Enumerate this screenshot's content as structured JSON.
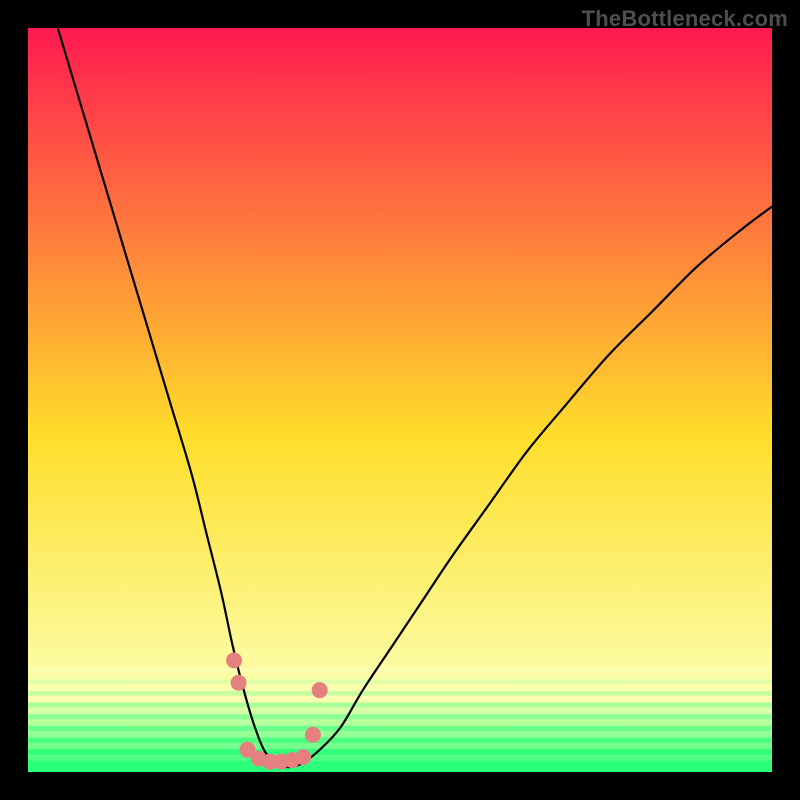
{
  "watermark": "TheBottleneck.com",
  "chart_data": {
    "type": "line",
    "title": "",
    "xlabel": "",
    "ylabel": "",
    "xlim": [
      0,
      100
    ],
    "ylim": [
      0,
      100
    ],
    "grid": false,
    "background_gradient": {
      "top_color": "#ff1a50",
      "mid_color": "#ffde2a",
      "band_color": "#fbffb0",
      "bottom_color": "#2cff7a"
    },
    "series": [
      {
        "name": "bottleneck-curve",
        "type": "line",
        "color": "#000000",
        "x": [
          4,
          7,
          10,
          13,
          16,
          19,
          22,
          24,
          26,
          27.5,
          29,
          30.5,
          32,
          34,
          36.5,
          39,
          42,
          45,
          49,
          53,
          57,
          62,
          67,
          72,
          78,
          84,
          90,
          96,
          100
        ],
        "y": [
          100,
          90,
          80,
          70,
          60,
          50,
          40,
          32,
          24,
          17,
          11,
          6,
          2.5,
          0.8,
          1.0,
          2.8,
          6,
          11,
          17,
          23,
          29,
          36,
          43,
          49,
          56,
          62,
          68,
          73,
          76
        ]
      },
      {
        "name": "bottleneck-markers",
        "type": "scatter",
        "color": "#e68080",
        "marker_size": 10,
        "x": [
          27.7,
          28.3,
          29.5,
          31.0,
          32.5,
          34.0,
          35.5,
          37.0,
          38.3,
          39.2
        ],
        "y": [
          15.0,
          12.0,
          3.0,
          1.8,
          1.4,
          1.4,
          1.6,
          2.0,
          5.0,
          11.0
        ]
      }
    ]
  }
}
